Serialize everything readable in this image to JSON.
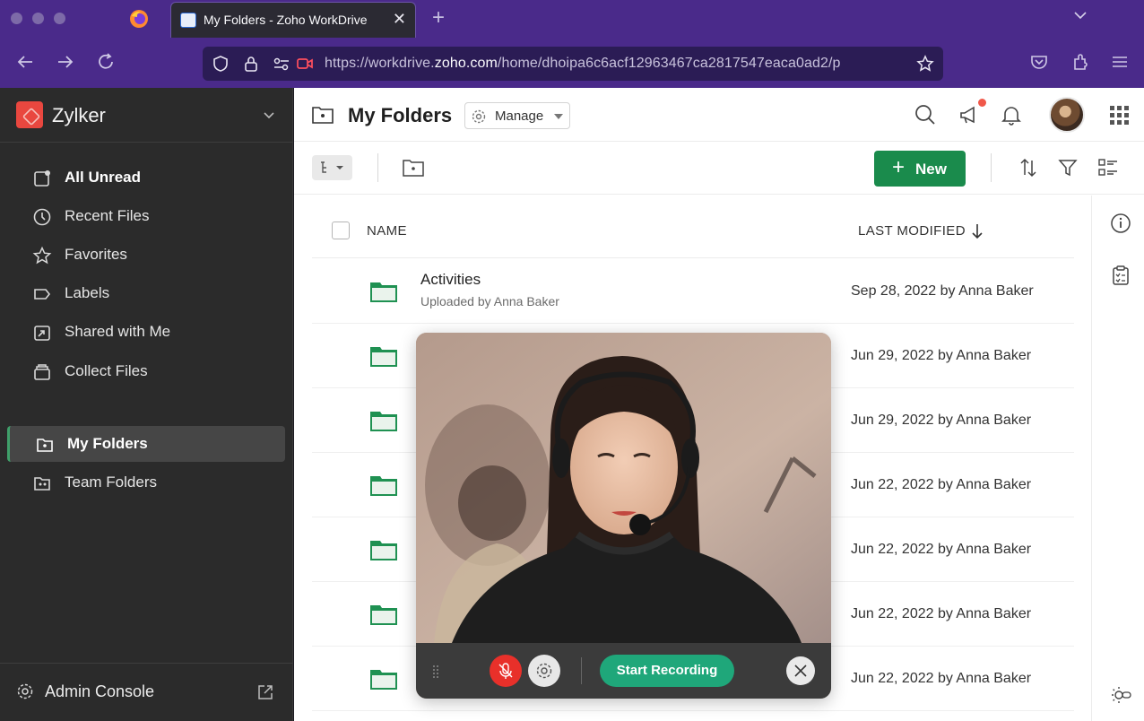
{
  "browser": {
    "tab_title": "My Folders - Zoho WorkDrive",
    "url_prefix": "https://workdrive.",
    "url_domain": "zoho.com",
    "url_path": "/home/dhoipa6c6acf12963467ca2817547eaca0ad2/p"
  },
  "sidebar": {
    "brand": "Zylker",
    "items": [
      {
        "label": "All Unread",
        "icon": "unread-icon"
      },
      {
        "label": "Recent Files",
        "icon": "clock-icon"
      },
      {
        "label": "Favorites",
        "icon": "star-icon"
      },
      {
        "label": "Labels",
        "icon": "label-icon"
      },
      {
        "label": "Shared with Me",
        "icon": "shared-icon"
      },
      {
        "label": "Collect Files",
        "icon": "collect-icon"
      },
      {
        "label": "My Folders",
        "icon": "my-folders-icon"
      },
      {
        "label": "Team Folders",
        "icon": "team-folders-icon"
      }
    ],
    "admin_label": "Admin Console"
  },
  "header": {
    "title": "My Folders",
    "manage_label": "Manage"
  },
  "toolbar": {
    "new_label": "New"
  },
  "table": {
    "col_name": "NAME",
    "col_modified": "LAST MODIFIED",
    "rows": [
      {
        "name": "Activities",
        "sub": "Uploaded by Anna Baker",
        "modified": "Sep 28, 2022 by Anna Baker"
      },
      {
        "name": "",
        "sub": "",
        "modified": "Jun 29, 2022 by Anna Baker"
      },
      {
        "name": "",
        "sub": "",
        "modified": "Jun 29, 2022 by Anna Baker"
      },
      {
        "name": "",
        "sub": "",
        "modified": "Jun 22, 2022 by Anna Baker"
      },
      {
        "name": "",
        "sub": "",
        "modified": "Jun 22, 2022 by Anna Baker"
      },
      {
        "name": "",
        "sub": "",
        "modified": "Jun 22, 2022 by Anna Baker"
      },
      {
        "name": "",
        "sub": "",
        "modified": "Jun 22, 2022 by Anna Baker"
      }
    ]
  },
  "video": {
    "record_label": "Start Recording"
  },
  "colors": {
    "accent_green": "#1a8b4c",
    "record_green": "#1fa77a",
    "browser_purple": "#4a2a8a",
    "sidebar_bg": "#2b2b2b"
  }
}
